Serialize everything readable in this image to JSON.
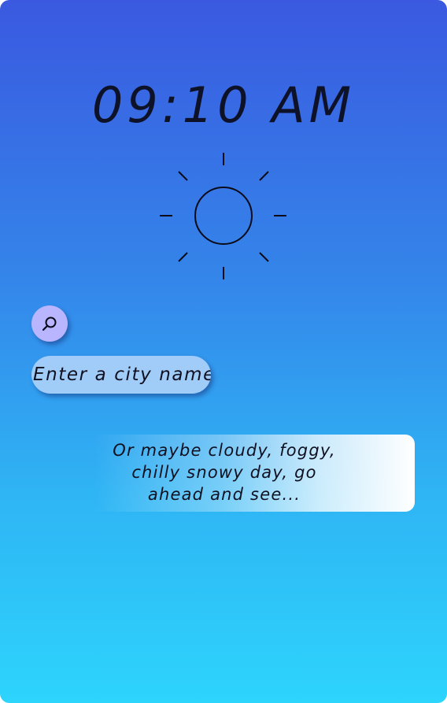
{
  "clock": {
    "time": "09:10 AM"
  },
  "weather": {
    "icon": "sun-icon"
  },
  "search": {
    "button_icon": "search-icon",
    "placeholder": "Enter a city name"
  },
  "hint": {
    "text": "Or maybe cloudy, foggy,\nchilly snowy day, go\nahead and see..."
  },
  "colors": {
    "gradient_top": "#3a59e0",
    "gradient_bottom": "#2dd4fc",
    "search_button": "#b9b6ff",
    "input_background": "#bad7fa"
  }
}
